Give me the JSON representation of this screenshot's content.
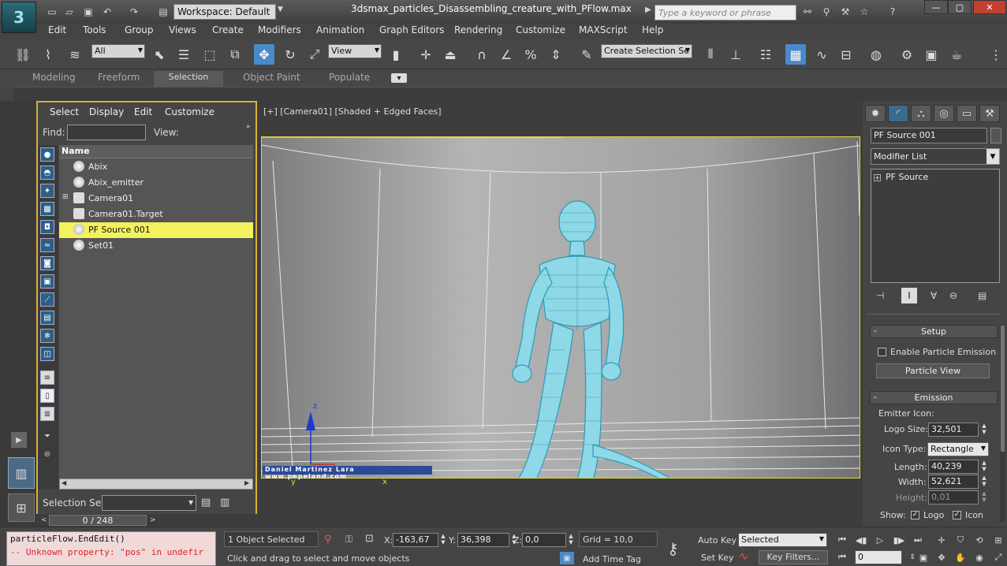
{
  "titlebar": {
    "workspace": "Workspace: Default",
    "document": "3dsmax_particles_Disassembling_creature_with_PFlow.max",
    "search_placeholder": "Type a keyword or phrase"
  },
  "menu": [
    "Edit",
    "Tools",
    "Group",
    "Views",
    "Create",
    "Modifiers",
    "Animation",
    "Graph Editors",
    "Rendering",
    "Customize",
    "MAXScript",
    "Help"
  ],
  "toolbar": {
    "filter": "All",
    "ref_coord": "View",
    "named_selection": "Create Selection Se"
  },
  "ribbon": {
    "tabs": [
      "Modeling",
      "Freeform",
      "Selection",
      "Object Paint",
      "Populate"
    ],
    "active": "Selection"
  },
  "explorer": {
    "menus": [
      "Select",
      "Display",
      "Edit",
      "Customize"
    ],
    "find_label": "Find:",
    "view_label": "View:",
    "column_name": "Name",
    "items": [
      {
        "label": "Abix",
        "selected": false
      },
      {
        "label": "Abix_emitter",
        "selected": false
      },
      {
        "label": "Camera01",
        "selected": false
      },
      {
        "label": "Camera01.Target",
        "selected": false
      },
      {
        "label": "PF Source 001",
        "selected": true
      },
      {
        "label": "Set01",
        "selected": false
      }
    ],
    "selection_set_label": "Selection Set:",
    "frame_counter": "0 / 248"
  },
  "viewport": {
    "label": "[+] [Camera01] [Shaded + Edged Faces]",
    "watermark": "Daniel Martinez Lara   www.pepeland.com",
    "axis_x": "x",
    "axis_y": "y",
    "axis_z": "z"
  },
  "command_panel": {
    "object_name": "PF Source 001",
    "modifier_list": "Modifier List",
    "stack_item": "PF Source",
    "setup": {
      "title": "Setup",
      "enable_emission": "Enable Particle Emission",
      "particle_view": "Particle View"
    },
    "emission": {
      "title": "Emission",
      "emitter_icon": "Emitter Icon:",
      "logo_size_label": "Logo Size:",
      "logo_size": "32,501",
      "icon_type_label": "Icon Type:",
      "icon_type": "Rectangle",
      "length_label": "Length:",
      "length": "40,239",
      "width_label": "Width:",
      "width": "52,621",
      "height_label": "Height:",
      "height": "0,01",
      "show_label": "Show:",
      "show_logo": "Logo",
      "show_icon": "Icon"
    }
  },
  "status": {
    "maxscript_line1": "particleFlow.EndEdit()",
    "maxscript_line2": "-- Unknown property: \"pos\" in undefir",
    "selection": "1 Object Selected",
    "prompt": "Click and drag to select and move objects",
    "x_label": "X:",
    "x": "-163,67",
    "y_label": "Y:",
    "y": "36,398",
    "z_label": "Z:",
    "z": "0,0",
    "grid": "Grid = 10,0",
    "add_time_tag": "Add Time Tag",
    "auto_key": "Auto Key",
    "set_key": "Set Key",
    "key_mode": "Selected",
    "key_filters": "Key Filters...",
    "frame": "0"
  }
}
